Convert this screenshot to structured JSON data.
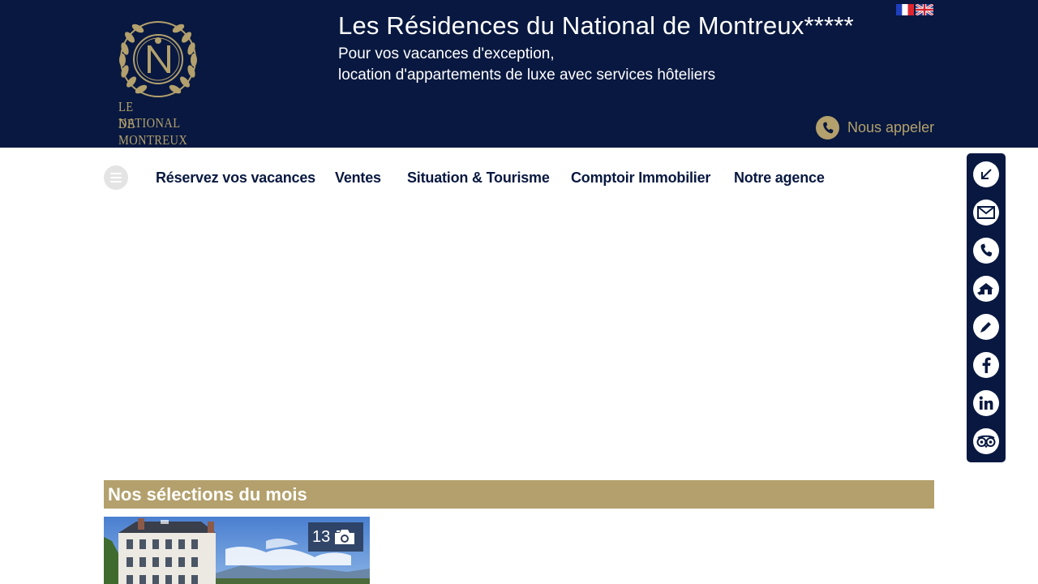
{
  "header": {
    "logo_line1": "LE NATIONAL",
    "logo_line2": "DE MONTREUX",
    "title": "Les Résidences du National de Montreux*****",
    "subtitle_line1": "Pour vos vacances d'exception,",
    "subtitle_line2": "location d'appartements de luxe avec services hôteliers",
    "call_label": "Nous appeler",
    "languages": [
      "fr",
      "en"
    ]
  },
  "nav": {
    "items": [
      {
        "label": "Réservez vos vacances"
      },
      {
        "label": "Ventes"
      },
      {
        "label": "Situation & Tourisme"
      },
      {
        "label": "Comptoir Immobilier"
      },
      {
        "label": "Notre agence"
      }
    ]
  },
  "sidebar": {
    "icons": [
      "collapse-arrow-icon",
      "mail-icon",
      "phone-icon",
      "property-estimate-icon",
      "pencil-icon",
      "facebook-icon",
      "linkedin-icon",
      "tripadvisor-icon"
    ]
  },
  "selections": {
    "title": "Nos sélections du mois",
    "cards": [
      {
        "photo_count": "13"
      }
    ]
  },
  "colors": {
    "navy": "#081840",
    "gold": "#b3a06c",
    "white": "#ffffff"
  }
}
